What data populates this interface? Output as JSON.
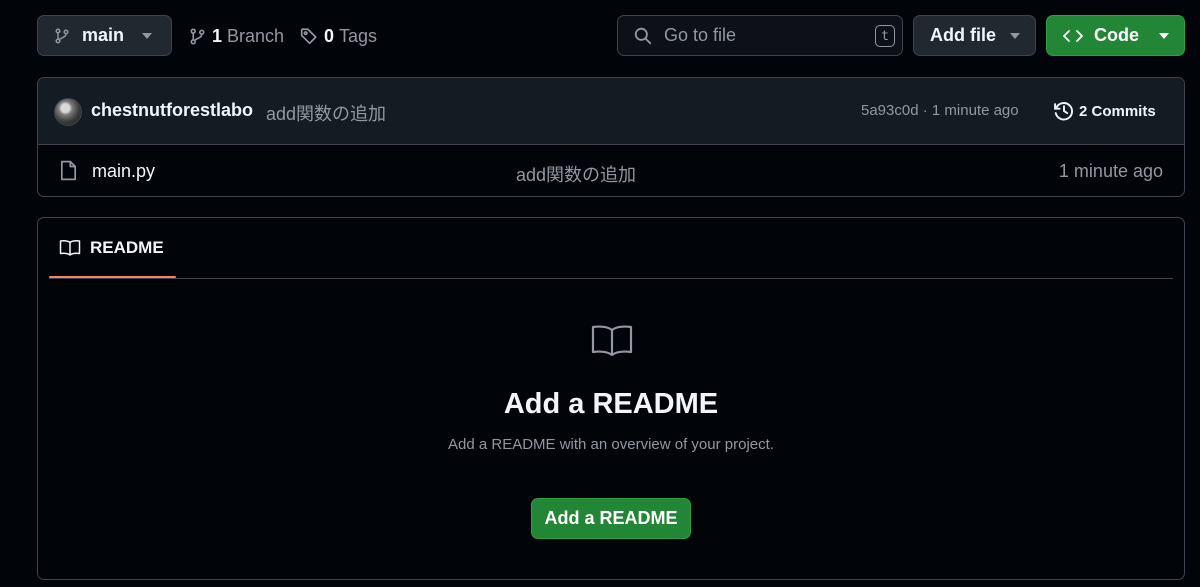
{
  "toolbar": {
    "branch_name": "main",
    "branch_count": "1",
    "branch_label": "Branch",
    "tag_count": "0",
    "tag_label": "Tags",
    "search_placeholder": "Go to file",
    "search_shortcut": "t",
    "add_file_label": "Add file",
    "code_label": "Code"
  },
  "latest_commit": {
    "author": "chestnutforestlabo",
    "message": "add関数の追加",
    "sha_time": "5a93c0d · 1 minute ago",
    "commits_label": "2 Commits"
  },
  "files": [
    {
      "name": "main.py",
      "message": "add関数の追加",
      "time": "1 minute ago"
    }
  ],
  "readme": {
    "tab_label": "README",
    "blank_title": "Add a README",
    "blank_description": "Add a README with an overview of your project.",
    "button_label": "Add a README"
  },
  "icons": {
    "branch": "git-branch-icon",
    "tag": "tag-icon",
    "search": "search-icon",
    "code": "code-icon",
    "history": "history-icon",
    "file": "file-icon",
    "book": "book-icon",
    "caret": "triangle-down-icon"
  },
  "colors": {
    "background": "#010409",
    "header_row": "#151b23",
    "border": "#3d444d",
    "primary_green": "#238636",
    "tab_accent": "#f78166",
    "text_primary": "#f0f6fc",
    "text_muted": "#9198a1"
  }
}
